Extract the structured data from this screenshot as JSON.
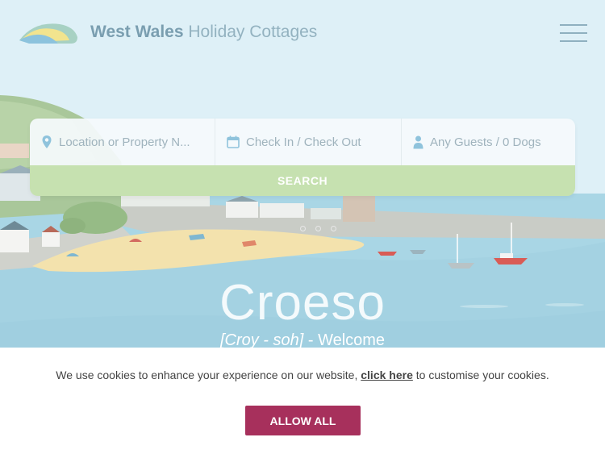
{
  "header": {
    "brand_bold": "West Wales",
    "brand_light": "Holiday Cottages",
    "logo_icon": "wave-logo",
    "menu_icon": "hamburger-menu-icon"
  },
  "search": {
    "location_placeholder": "Location or Property N...",
    "dates_placeholder": "Check In / Check Out",
    "guests_placeholder": "Any Guests / 0 Dogs",
    "button_label": "SEARCH",
    "location_icon": "map-pin-icon",
    "dates_icon": "calendar-icon",
    "guests_icon": "person-icon"
  },
  "carousel": {
    "slide_count": 3
  },
  "hero": {
    "title": "Croeso",
    "pronunciation": "[Croy - soh]",
    "subtitle_rest": " - Welcome"
  },
  "cookie_banner": {
    "text_before": "We use cookies to enhance your experience on our website, ",
    "link_label": "click here",
    "text_after": " to customise your cookies.",
    "button_label": "ALLOW ALL"
  },
  "colors": {
    "sky": "#def0f7",
    "sea": "#a9d6e5",
    "sand": "#f3e2ad",
    "search_button": "#c6e1b0",
    "allow_button": "#a7305c"
  }
}
